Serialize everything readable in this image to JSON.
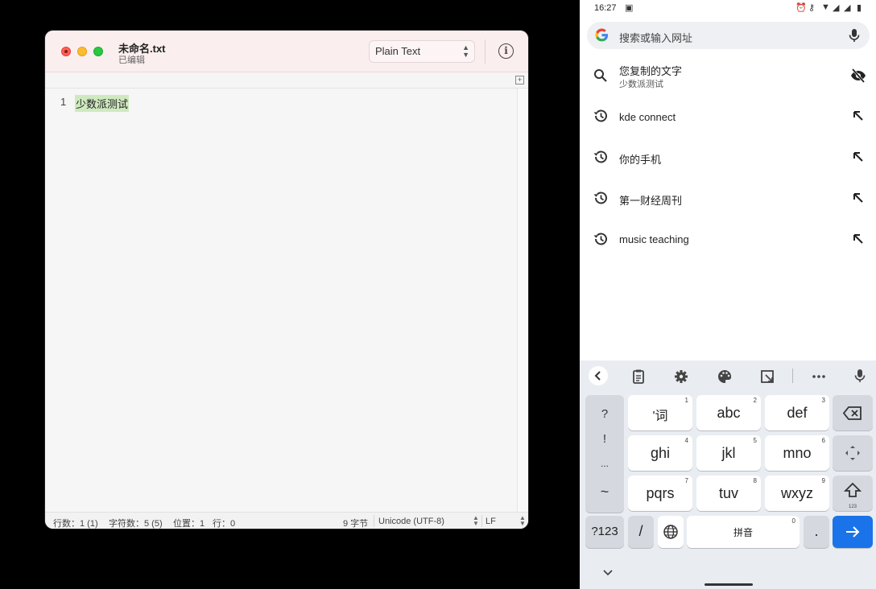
{
  "mac_editor": {
    "title": "未命名.txt",
    "subtitle": "已编辑",
    "syntax_mode": "Plain Text",
    "info_label": "i",
    "lines": [
      {
        "number": "1",
        "text": "少数派测试"
      }
    ],
    "status": {
      "line_count": "行数：1 (1)",
      "char_count": "字符数：5 (5)",
      "position": "位置：1",
      "row": "行：0",
      "bytes": "9 字节",
      "encoding": "Unicode (UTF-8)",
      "line_ending": "LF"
    },
    "colors": {
      "titlebar": "#fbeeee",
      "highlight": "#cfe9bf",
      "close": "#fe5f57",
      "minimize": "#febc2e",
      "maximize": "#28c840"
    }
  },
  "android": {
    "status_bar": {
      "time": "16:27"
    },
    "search": {
      "placeholder": "搜索或输入网址",
      "logo": "G"
    },
    "suggestions": [
      {
        "icon": "search-icon",
        "title": "您复制的文字",
        "subtitle": "少数派测试",
        "action": "eye-off-icon"
      },
      {
        "icon": "history-icon",
        "title": "kde connect",
        "action": "arrow-up-left-icon"
      },
      {
        "icon": "history-icon",
        "title": "你的手机",
        "action": "arrow-up-left-icon"
      },
      {
        "icon": "history-icon",
        "title": "第一财经周刊",
        "action": "arrow-up-left-icon"
      },
      {
        "icon": "history-icon",
        "title": "music teaching",
        "action": "arrow-up-left-icon"
      }
    ],
    "keyboard": {
      "toolbar": [
        "chevron-left-icon",
        "clipboard-icon",
        "gear-icon",
        "palette-icon",
        "resize-icon",
        "more-icon",
        "mic-icon"
      ],
      "symbols": [
        "?",
        "!",
        "...",
        "~"
      ],
      "rows": [
        [
          {
            "label": "'词",
            "num": "1"
          },
          {
            "label": "abc",
            "num": "2"
          },
          {
            "label": "def",
            "num": "3"
          }
        ],
        [
          {
            "label": "ghi",
            "num": "4"
          },
          {
            "label": "jkl",
            "num": "5"
          },
          {
            "label": "mno",
            "num": "6"
          }
        ],
        [
          {
            "label": "pqrs",
            "num": "7"
          },
          {
            "label": "tuv",
            "num": "8"
          },
          {
            "label": "wxyz",
            "num": "9"
          }
        ]
      ],
      "mode_key": "?123",
      "slash_key": "/",
      "space_key": "拼音",
      "space_num": "0",
      "period_key": ".",
      "shift_sub": "123",
      "accent": "#1a73e8"
    }
  }
}
